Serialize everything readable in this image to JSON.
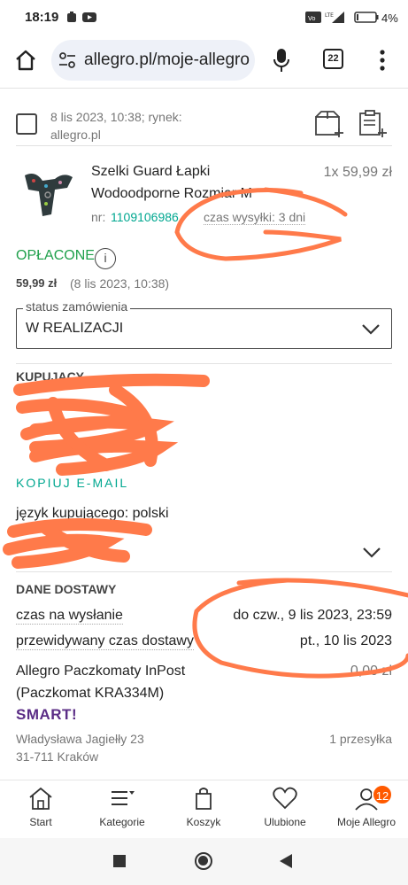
{
  "status_bar": {
    "time": "18:19",
    "battery": "4%"
  },
  "browser": {
    "url": "allegro.pl/moje-allegro",
    "tab_count": "22"
  },
  "order_header": {
    "date_line1": "8 lis 2023, 10:38; rynek:",
    "date_line2": "allegro.pl"
  },
  "item": {
    "title_line1": "Szelki Guard Łapki",
    "title_line2": "Wodoodporne Rozmiar M",
    "quantity_price": "1x 59,99 zł",
    "nr_label": "nr:",
    "nr_value": "1109106986",
    "shipping_time": "czas wysyłki: 3 dni"
  },
  "payment": {
    "status": "OPŁACONE",
    "amount": "59,99 zł",
    "date": "(8 lis 2023, 10:38)"
  },
  "order_status": {
    "label": "status zamówienia",
    "value": "W REALIZACJI"
  },
  "buyer": {
    "heading": "KUPUJĄCY",
    "copy_email": "KOPIUJ E-MAIL",
    "language_line": "język kupującego: polski"
  },
  "delivery": {
    "heading": "DANE DOSTAWY",
    "dispatch_label": "czas na wysłanie",
    "dispatch_value": "do czw., 9 lis 2023, 23:59",
    "expected_label": "przewidywany czas dostawy",
    "expected_value": "pt., 10 lis 2023",
    "method_line1": "Allegro Paczkomaty InPost",
    "method_line2": "(Paczkomat KRA334M)",
    "method_price": "0,00 zł",
    "smart_label": "SMART!",
    "address_line1": "Władysława Jagiełły 23",
    "address_line2": "31-711 Kraków",
    "packages": "1 przesyłka"
  },
  "bottom_nav": [
    {
      "label": "Start",
      "icon": "home-icon"
    },
    {
      "label": "Kategorie",
      "icon": "menu-icon"
    },
    {
      "label": "Koszyk",
      "icon": "cart-icon"
    },
    {
      "label": "Ulubione",
      "icon": "heart-icon"
    },
    {
      "label": "Moje Allegro",
      "icon": "user-icon",
      "badge": "12"
    }
  ],
  "colors": {
    "accent": "#ff5a00",
    "teal": "#00a790",
    "paid_green": "#1fa04b",
    "smart_purple": "#5b2d86",
    "annotation": "#ff7a4a"
  }
}
